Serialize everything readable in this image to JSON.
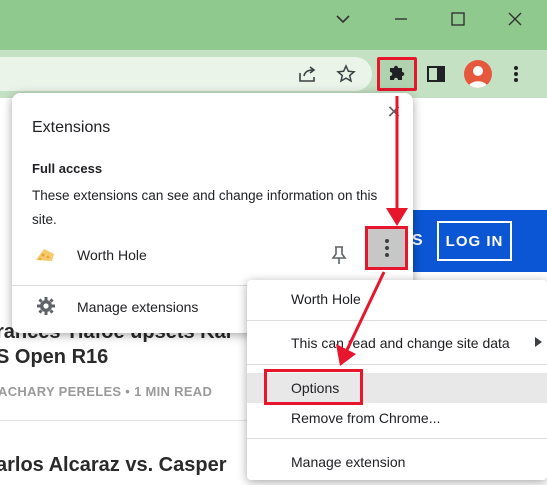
{
  "window": {
    "controls": [
      "chevron-down-icon",
      "minimize-icon",
      "maximize-icon",
      "close-icon"
    ]
  },
  "toolbar": {
    "icons": [
      "share-icon",
      "star-icon",
      "puzzle-icon",
      "side-panel-icon",
      "avatar",
      "kebab-menu-icon"
    ]
  },
  "page": {
    "login_label": "LOG IN",
    "partial_s": "S",
    "headline1_line1": "rances Tiafoe upsets Kar",
    "headline1_line2": "S Open R16",
    "byline1": "ACHARY PERELES  •  1 MIN READ",
    "headline2_line1": "arlos Alcaraz vs. Casper"
  },
  "extensions_popup": {
    "title": "Extensions",
    "full_access_heading": "Full access",
    "description": "These extensions can see and change information on this site.",
    "extension_name": "Worth Hole",
    "manage_label": "Manage extensions"
  },
  "context_menu": {
    "items": [
      {
        "label": "Worth Hole"
      },
      {
        "label": "This can read and change site data"
      },
      {
        "label": "Options"
      },
      {
        "label": "Remove from Chrome..."
      },
      {
        "label": "Manage extension"
      }
    ]
  },
  "colors": {
    "annotation_red": "#e8162d",
    "title_bar": "#8fc98d",
    "toolbar": "#c5e1c3",
    "brand_blue": "#0b56d4"
  }
}
